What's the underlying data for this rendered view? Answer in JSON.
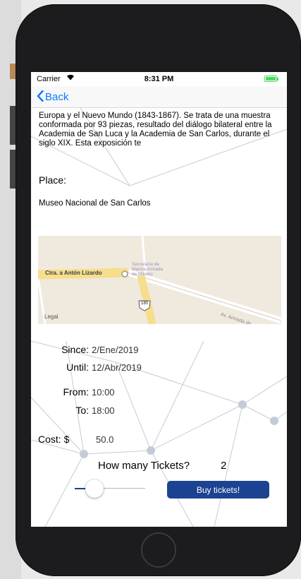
{
  "status_bar": {
    "carrier": "Carrier",
    "wifi_icon": "wifi-icon",
    "time": "8:31 PM",
    "battery_icon": "battery-icon"
  },
  "nav": {
    "back_label": "Back",
    "back_icon": "chevron-left-icon"
  },
  "description": "Europa y el Nuevo Mundo (1843-1867). Se trata de una muestra conformada por 93 piezas, resultado del diálogo bilateral entre la Academia de San Luca y la Academia de San Carlos, durante el siglo XIX. Esta exposición te",
  "place": {
    "label": "Place:",
    "value": "Museo Nacional de San Carlos"
  },
  "map": {
    "road_label": "Ctra. a Antón Lizardo",
    "poi_label": "Secretaría de Marina Armada de México",
    "highway_shield": "180",
    "legal": "Legal",
    "street_label": "Av. Armada de"
  },
  "since": {
    "label": "Since:",
    "value": "2/Ene/2019"
  },
  "until": {
    "label": "Until:",
    "value": "12/Abr/2019"
  },
  "from": {
    "label": "From:",
    "value": "10:00"
  },
  "to": {
    "label": "To:",
    "value": "18:00"
  },
  "cost": {
    "label": "Cost: $",
    "value": "50.0"
  },
  "tickets": {
    "label": "How many Tickets?",
    "value": "2",
    "slider_fraction": 0.2
  },
  "buy_button": "Buy tickets!",
  "colors": {
    "accent": "#0a7aff",
    "button": "#1c4391",
    "slider_active": "#1e3f88",
    "network": "#c4cbd8"
  }
}
